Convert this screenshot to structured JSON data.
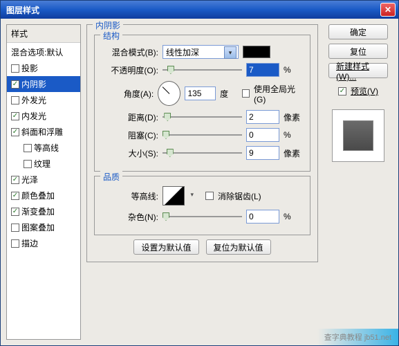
{
  "window": {
    "title": "图层样式"
  },
  "left": {
    "header": "样式",
    "blend_defaults": "混合选项:默认",
    "items": [
      {
        "key": "drop_shadow",
        "label": "投影",
        "checked": false
      },
      {
        "key": "inner_shadow",
        "label": "内阴影",
        "checked": true,
        "selected": true
      },
      {
        "key": "outer_glow",
        "label": "外发光",
        "checked": false
      },
      {
        "key": "inner_glow",
        "label": "内发光",
        "checked": true
      },
      {
        "key": "bevel",
        "label": "斜面和浮雕",
        "checked": true
      },
      {
        "key": "contour",
        "label": "等高线",
        "checked": false,
        "indent": true
      },
      {
        "key": "texture",
        "label": "纹理",
        "checked": false,
        "indent": true
      },
      {
        "key": "satin",
        "label": "光泽",
        "checked": true
      },
      {
        "key": "color_overlay",
        "label": "颜色叠加",
        "checked": true
      },
      {
        "key": "gradient_overlay",
        "label": "渐变叠加",
        "checked": true
      },
      {
        "key": "pattern_overlay",
        "label": "图案叠加",
        "checked": false
      },
      {
        "key": "stroke",
        "label": "描边",
        "checked": false
      }
    ]
  },
  "panel": {
    "title": "内阴影",
    "structure": {
      "legend": "结构",
      "blend_mode_label": "混合模式(B):",
      "blend_mode_value": "线性加深",
      "opacity_label": "不透明度(O):",
      "opacity_value": "7",
      "opacity_unit": "%",
      "angle_label": "角度(A):",
      "angle_value": "135",
      "angle_unit": "度",
      "global_light_label": "使用全局光(G)",
      "distance_label": "距离(D):",
      "distance_value": "2",
      "distance_unit": "像素",
      "choke_label": "阻塞(C):",
      "choke_value": "0",
      "choke_unit": "%",
      "size_label": "大小(S):",
      "size_value": "9",
      "size_unit": "像素"
    },
    "quality": {
      "legend": "品质",
      "contour_label": "等高线:",
      "antialias_label": "消除锯齿(L)",
      "noise_label": "杂色(N):",
      "noise_value": "0",
      "noise_unit": "%"
    },
    "buttons": {
      "make_default": "设置为默认值",
      "reset_default": "复位为默认值"
    }
  },
  "right": {
    "ok": "确定",
    "cancel": "复位",
    "new_style": "新建样式(W)...",
    "preview": "预览(V)"
  },
  "watermark": "查字典教程 jb51.net"
}
